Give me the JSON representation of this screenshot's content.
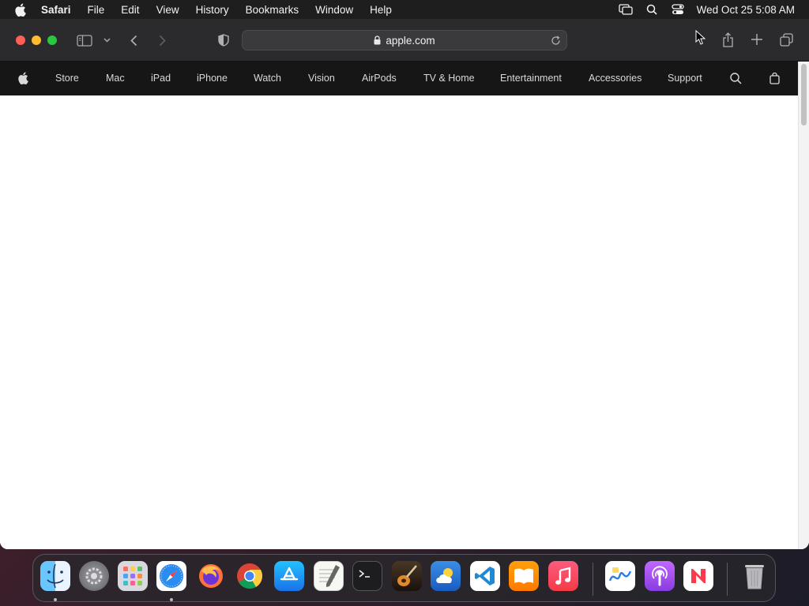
{
  "menubar": {
    "apple_icon": "apple-logo-icon",
    "app_name": "Safari",
    "items": [
      "File",
      "Edit",
      "View",
      "History",
      "Bookmarks",
      "Window",
      "Help"
    ],
    "status_icons": [
      "screen-mirroring-icon",
      "spotlight-search-icon",
      "control-center-icon"
    ],
    "clock": "Wed Oct 25  5:08 AM"
  },
  "browser": {
    "url": "apple.com",
    "toolbar_icons": [
      "sidebar-icon",
      "chevron-down-icon",
      "back-icon",
      "forward-icon",
      "privacy-shield-icon",
      "share-icon",
      "new-tab-icon",
      "tab-overview-icon"
    ]
  },
  "site_nav": {
    "items": [
      "Store",
      "Mac",
      "iPad",
      "iPhone",
      "Watch",
      "Vision",
      "AirPods",
      "TV & Home",
      "Entertainment",
      "Accessories",
      "Support"
    ],
    "icons": [
      "apple-logo-icon",
      "search-icon",
      "shopping-bag-icon"
    ]
  },
  "dock": {
    "apps": [
      "Finder",
      "System Settings",
      "Launchpad",
      "Safari",
      "Firefox",
      "Chrome",
      "App Store",
      "TextEdit",
      "Terminal",
      "GarageBand",
      "Weather",
      "VS Code",
      "Books",
      "Music",
      "Freeform",
      "Podcasts",
      "News",
      "Trash"
    ],
    "running": [
      "Finder",
      "Safari"
    ]
  },
  "colors": {
    "menubar_bg": "#1e1e1e",
    "toolbar_bg": "#2b2b2d",
    "sitenav_bg": "#161617",
    "close": "#ff5f57",
    "minimize": "#febc2e",
    "maximize": "#28c840"
  }
}
